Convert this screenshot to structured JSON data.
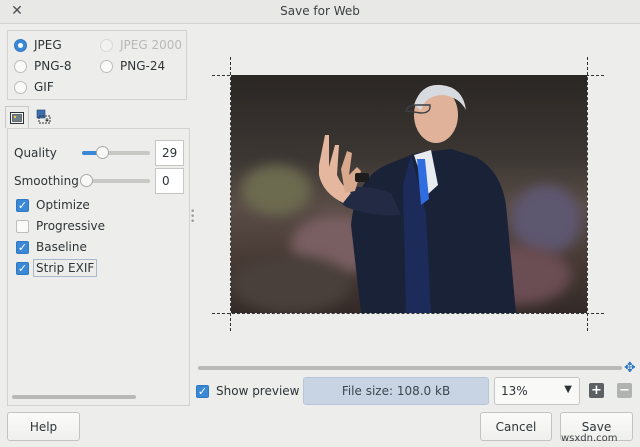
{
  "window": {
    "title": "Save for Web",
    "close_glyph": "✕"
  },
  "formats": {
    "options": [
      {
        "label": "JPEG",
        "selected": true,
        "enabled": true
      },
      {
        "label": "JPEG 2000",
        "selected": false,
        "enabled": false
      },
      {
        "label": "PNG-8",
        "selected": false,
        "enabled": true
      },
      {
        "label": "PNG-24",
        "selected": false,
        "enabled": true
      },
      {
        "label": "GIF",
        "selected": false,
        "enabled": true
      }
    ]
  },
  "tabs": [
    {
      "icon": "image-settings-icon",
      "active": true
    },
    {
      "icon": "image-resize-icon",
      "active": false
    }
  ],
  "settings": {
    "quality_label": "Quality",
    "quality_value": "29",
    "quality_fraction": 0.29,
    "smoothing_label": "Smoothing",
    "smoothing_value": "0",
    "smoothing_fraction": 0,
    "options": [
      {
        "label": "Optimize",
        "checked": true
      },
      {
        "label": "Progressive",
        "checked": false
      },
      {
        "label": "Baseline",
        "checked": true
      },
      {
        "label": "Strip EXIF",
        "checked": true
      }
    ]
  },
  "preview": {
    "image_description": "photo of a man in a suit gesturing",
    "show_preview_label": "Show preview",
    "show_preview_checked": true,
    "file_size": "File size: 108.0 kB",
    "zoom_value": "13%",
    "zoom_in_glyph": "+",
    "zoom_out_glyph": "−",
    "move_icon_glyph": "✥"
  },
  "buttons": {
    "help": "Help",
    "cancel": "Cancel",
    "save": "Save"
  },
  "watermark": "wsxdn.com",
  "colors": {
    "accent": "#3b88d6",
    "filesize_bg": "#c8d4e3"
  }
}
